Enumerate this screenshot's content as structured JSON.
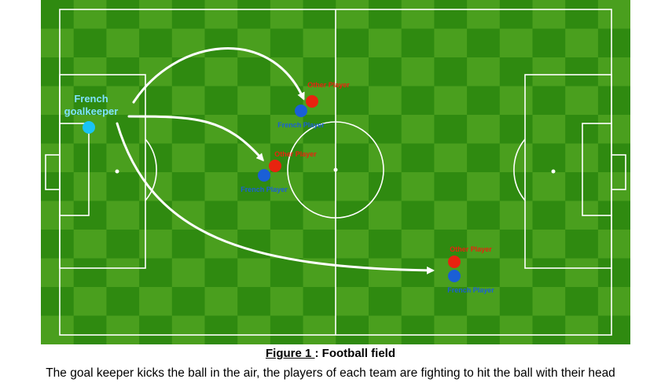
{
  "field": {
    "colors": {
      "grass_dark": "#2f8a10",
      "grass_light": "#4a9f1e",
      "lines": "#ffffff"
    },
    "goalkeeper": {
      "label_line1": "French",
      "label_line2": "goalkeeper",
      "color": "#19c3f5"
    },
    "players": [
      {
        "other_label": "Other Player",
        "french_label": "French Player"
      },
      {
        "other_label": "Other Player",
        "french_label": "French Player"
      },
      {
        "other_label": "Other Player",
        "french_label": "French Player"
      }
    ],
    "other_color": "#e8230f",
    "french_color": "#1a5fd6",
    "arrow_color": "#ffffff"
  },
  "caption": {
    "figure_label": "Figure 1 ",
    "figure_sep": ": ",
    "figure_title": "Football field",
    "description": "The goal keeper kicks the ball in the air, the players of each team are fighting to hit the ball with their head"
  }
}
